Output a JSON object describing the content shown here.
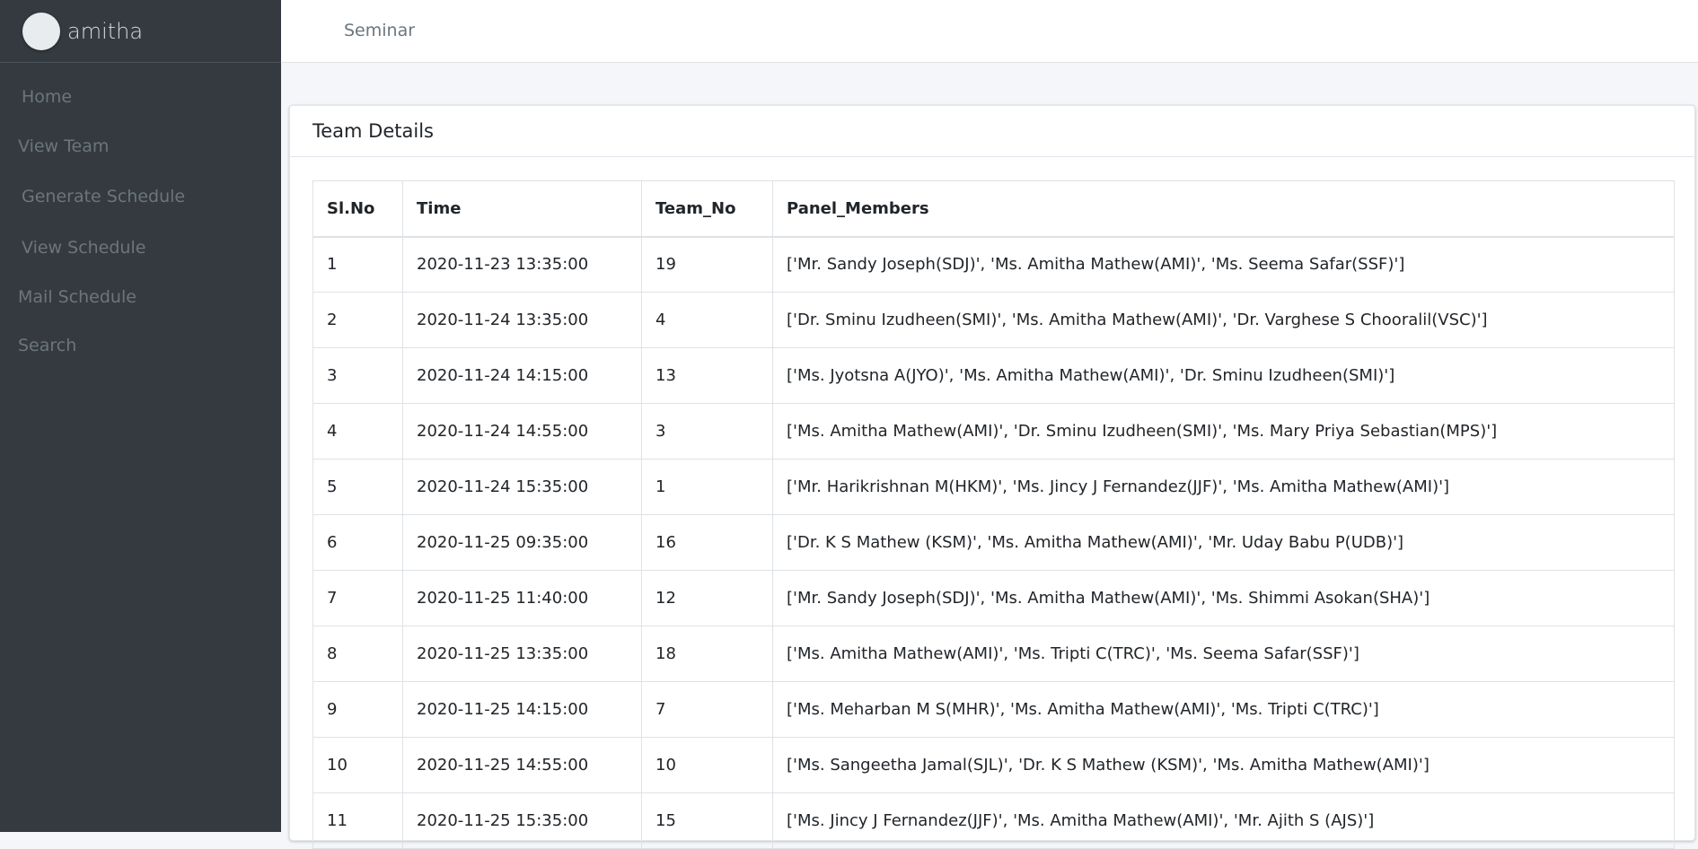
{
  "sidebar": {
    "brand": "amitha",
    "items": [
      {
        "label": "Home"
      },
      {
        "label": "View Team"
      },
      {
        "label": "Generate Schedule"
      },
      {
        "label": "View Schedule"
      },
      {
        "label": "Mail Schedule"
      },
      {
        "label": "Search"
      }
    ]
  },
  "topbar": {
    "link": "Seminar"
  },
  "card": {
    "title": "Team Details"
  },
  "table": {
    "headers": [
      "Sl.No",
      "Time",
      "Team_No",
      "Panel_Members"
    ],
    "rows": [
      [
        "1",
        "2020-11-23 13:35:00",
        "19",
        "['Mr. Sandy Joseph(SDJ)', 'Ms. Amitha Mathew(AMI)', 'Ms. Seema Safar(SSF)']"
      ],
      [
        "2",
        "2020-11-24 13:35:00",
        "4",
        "['Dr. Sminu Izudheen(SMI)', 'Ms. Amitha Mathew(AMI)', 'Dr. Varghese S Chooralil(VSC)']"
      ],
      [
        "3",
        "2020-11-24 14:15:00",
        "13",
        "['Ms. Jyotsna A(JYO)', 'Ms. Amitha Mathew(AMI)', 'Dr. Sminu Izudheen(SMI)']"
      ],
      [
        "4",
        "2020-11-24 14:55:00",
        "3",
        "['Ms. Amitha Mathew(AMI)', 'Dr. Sminu Izudheen(SMI)', 'Ms. Mary Priya Sebastian(MPS)']"
      ],
      [
        "5",
        "2020-11-24 15:35:00",
        "1",
        "['Mr. Harikrishnan M(HKM)', 'Ms. Jincy J Fernandez(JJF)', 'Ms. Amitha Mathew(AMI)']"
      ],
      [
        "6",
        "2020-11-25 09:35:00",
        "16",
        "['Dr. K S Mathew (KSM)', 'Ms. Amitha Mathew(AMI)', 'Mr. Uday Babu P(UDB)']"
      ],
      [
        "7",
        "2020-11-25 11:40:00",
        "12",
        "['Mr. Sandy Joseph(SDJ)', 'Ms. Amitha Mathew(AMI)', 'Ms. Shimmi Asokan(SHA)']"
      ],
      [
        "8",
        "2020-11-25 13:35:00",
        "18",
        "['Ms. Amitha Mathew(AMI)', 'Ms. Tripti C(TRC)', 'Ms. Seema Safar(SSF)']"
      ],
      [
        "9",
        "2020-11-25 14:15:00",
        "7",
        "['Ms. Meharban M S(MHR)', 'Ms. Amitha Mathew(AMI)', 'Ms. Tripti C(TRC)']"
      ],
      [
        "10",
        "2020-11-25 14:55:00",
        "10",
        "['Ms. Sangeetha Jamal(SJL)', 'Dr. K S Mathew (KSM)', 'Ms. Amitha Mathew(AMI)']"
      ],
      [
        "11",
        "2020-11-25 15:35:00",
        "15",
        "['Ms. Jincy J Fernandez(JJF)', 'Ms. Amitha Mathew(AMI)', 'Mr. Ajith S (AJS)']"
      ]
    ]
  }
}
